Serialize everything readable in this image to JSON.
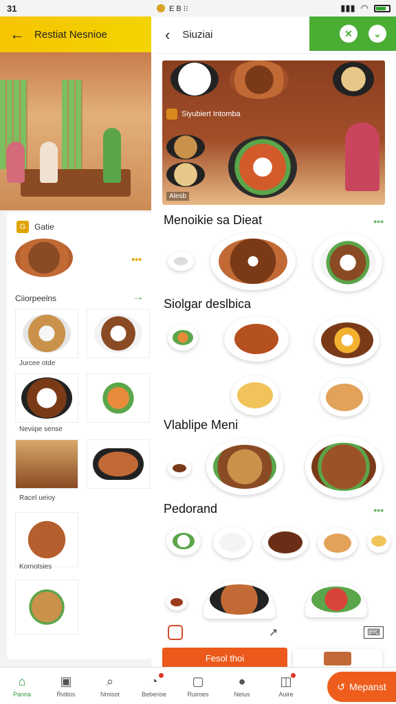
{
  "status_bar": {
    "left": "31",
    "time_icons": "E B ⁝⁝"
  },
  "left_panel": {
    "title": "Restiat Nesnioe",
    "card_name": "Gatie",
    "section": "Ciiorpeelns",
    "tiles": [
      {
        "label": "Jurcee otde"
      },
      {
        "label": "Neviipe sense"
      },
      {
        "label": "Racel ueioy"
      },
      {
        "label": "Kornotsies"
      }
    ]
  },
  "right_panel": {
    "title": "Siuziai",
    "hero_label": "Siyubiert Intomba",
    "hero_tag": "Alesb",
    "sections": [
      {
        "title": "Menoikie sa Dieat",
        "more": "•••"
      },
      {
        "title": "Siolgar deslbica"
      },
      {
        "title": "Vlablipe Meni"
      },
      {
        "title": "Pedorand",
        "more": "•••"
      }
    ],
    "order_button": "Fesol thoi"
  },
  "bottom_nav": {
    "items": [
      {
        "label": "Panna",
        "icon": "home-icon",
        "active": true
      },
      {
        "label": "Rvitlos",
        "icon": "gallery-icon"
      },
      {
        "label": "Nmisot",
        "icon": "search-icon"
      },
      {
        "label": "Beberioe",
        "icon": "alert-icon"
      },
      {
        "label": "Ruiroes",
        "icon": "notice-icon"
      },
      {
        "label": "Neius",
        "icon": "chat-icon"
      },
      {
        "label": "Auire",
        "icon": "cart-icon"
      }
    ],
    "cta": "Mepanst"
  },
  "colors": {
    "accent": "#4aad34",
    "brand": "#ef5d1c",
    "header_yellow": "#f6c400"
  }
}
